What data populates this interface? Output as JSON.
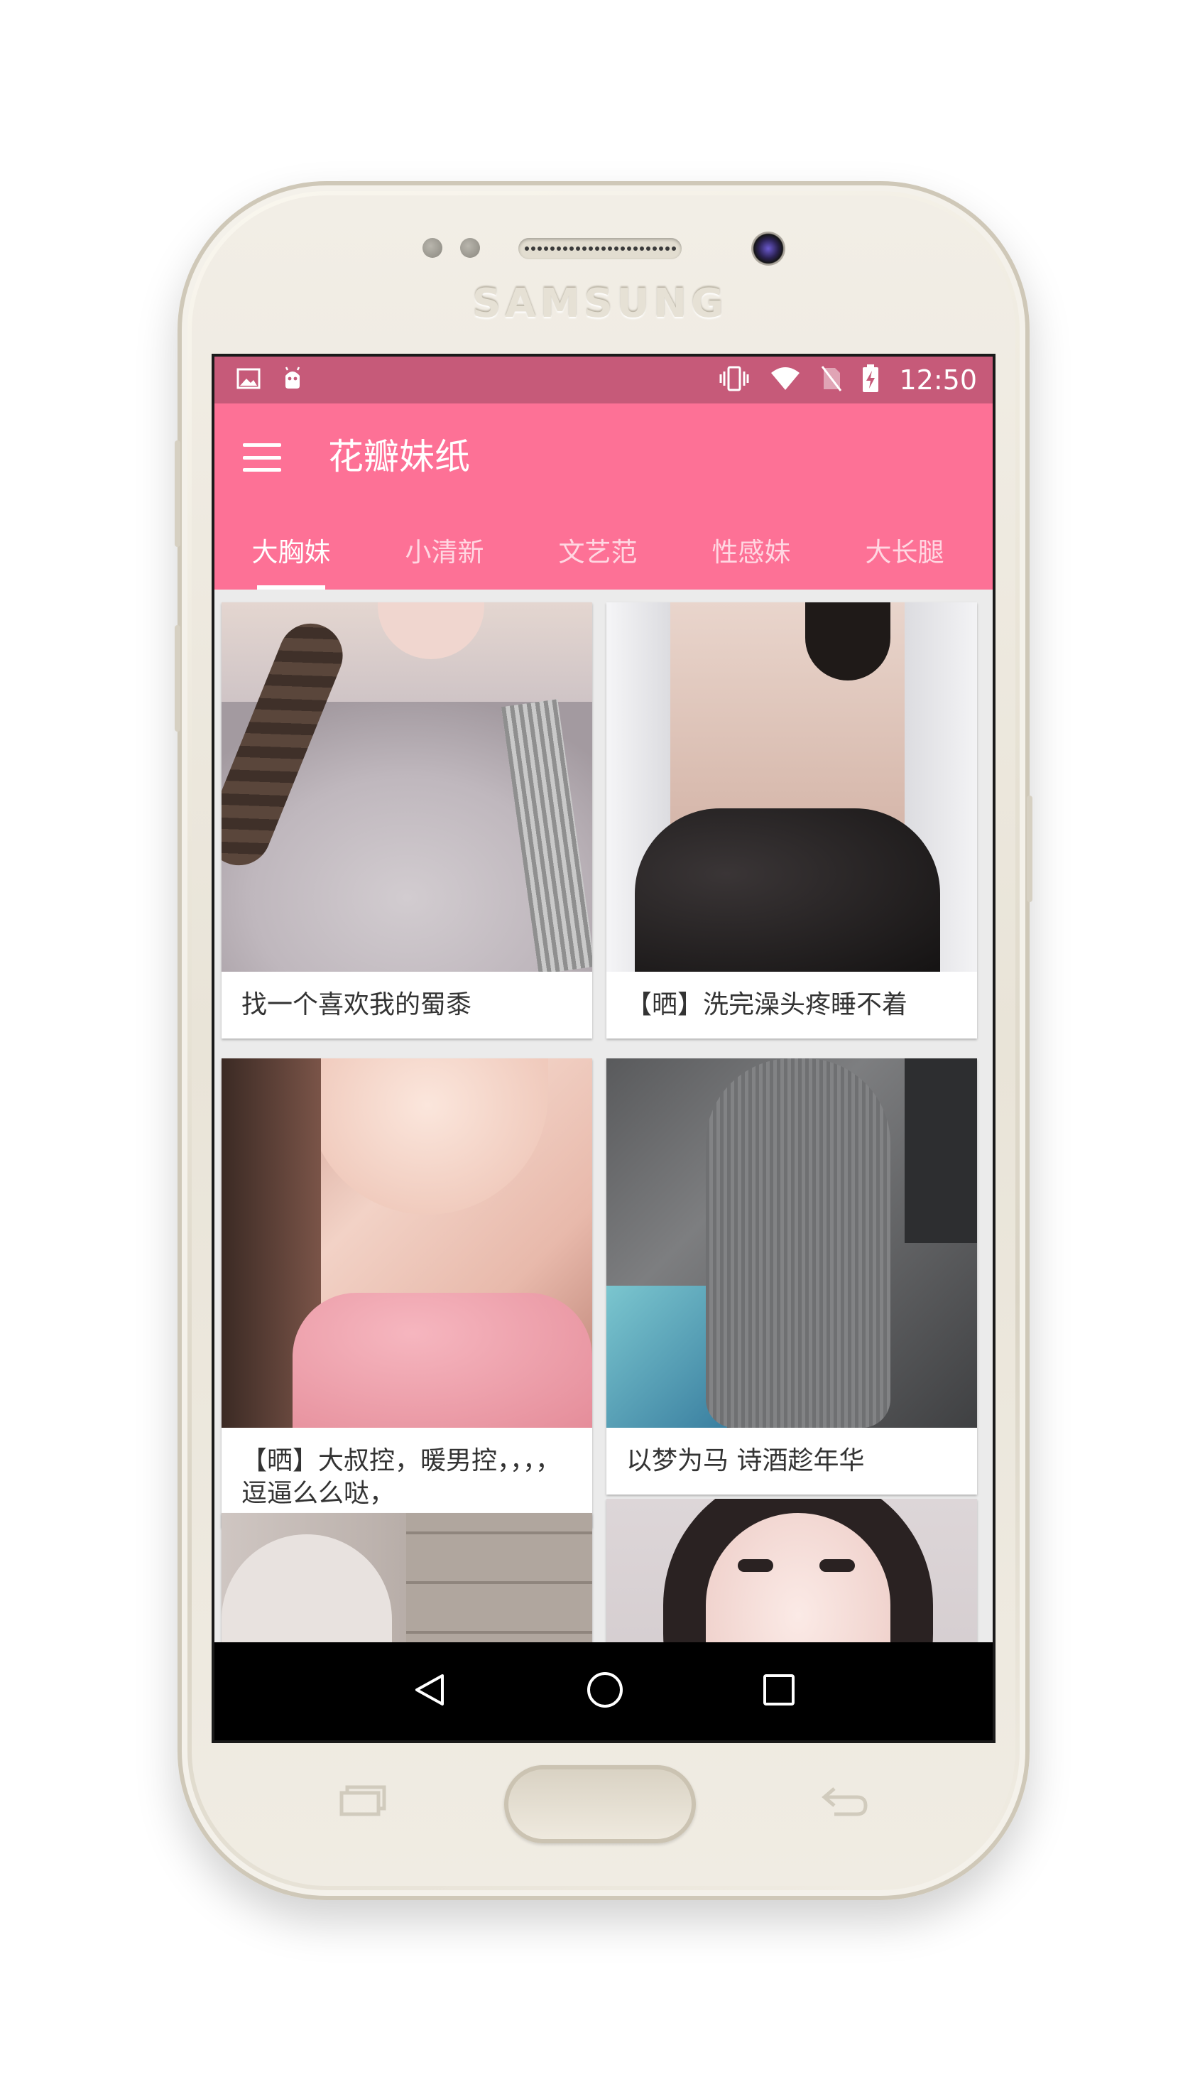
{
  "device": {
    "brand": "SAMSUNG"
  },
  "status_bar": {
    "time": "12:50",
    "color": "#c65a79"
  },
  "app_bar": {
    "title": "花瓣妹纸",
    "color": "#fd7196"
  },
  "tabs": [
    {
      "label": "大胸妹",
      "active": true
    },
    {
      "label": "小清新",
      "active": false
    },
    {
      "label": "文艺范",
      "active": false
    },
    {
      "label": "性感妹",
      "active": false
    },
    {
      "label": "大长腿",
      "active": false
    }
  ],
  "cards": [
    {
      "title": "找一个喜欢我的蜀黍"
    },
    {
      "title": "【晒】洗完澡头疼睡不着"
    },
    {
      "title": "【晒】大叔控，暖男控，，，，逗逼么么哒，"
    },
    {
      "title": "以梦为马 诗酒趁年华"
    }
  ],
  "icons": {
    "status_left": [
      "image-notification-icon",
      "android-notification-icon"
    ],
    "status_right": [
      "vibrate-icon",
      "wifi-icon",
      "no-sim-icon",
      "battery-charging-icon"
    ],
    "navigation": [
      "back-icon",
      "home-icon",
      "recents-icon"
    ]
  }
}
